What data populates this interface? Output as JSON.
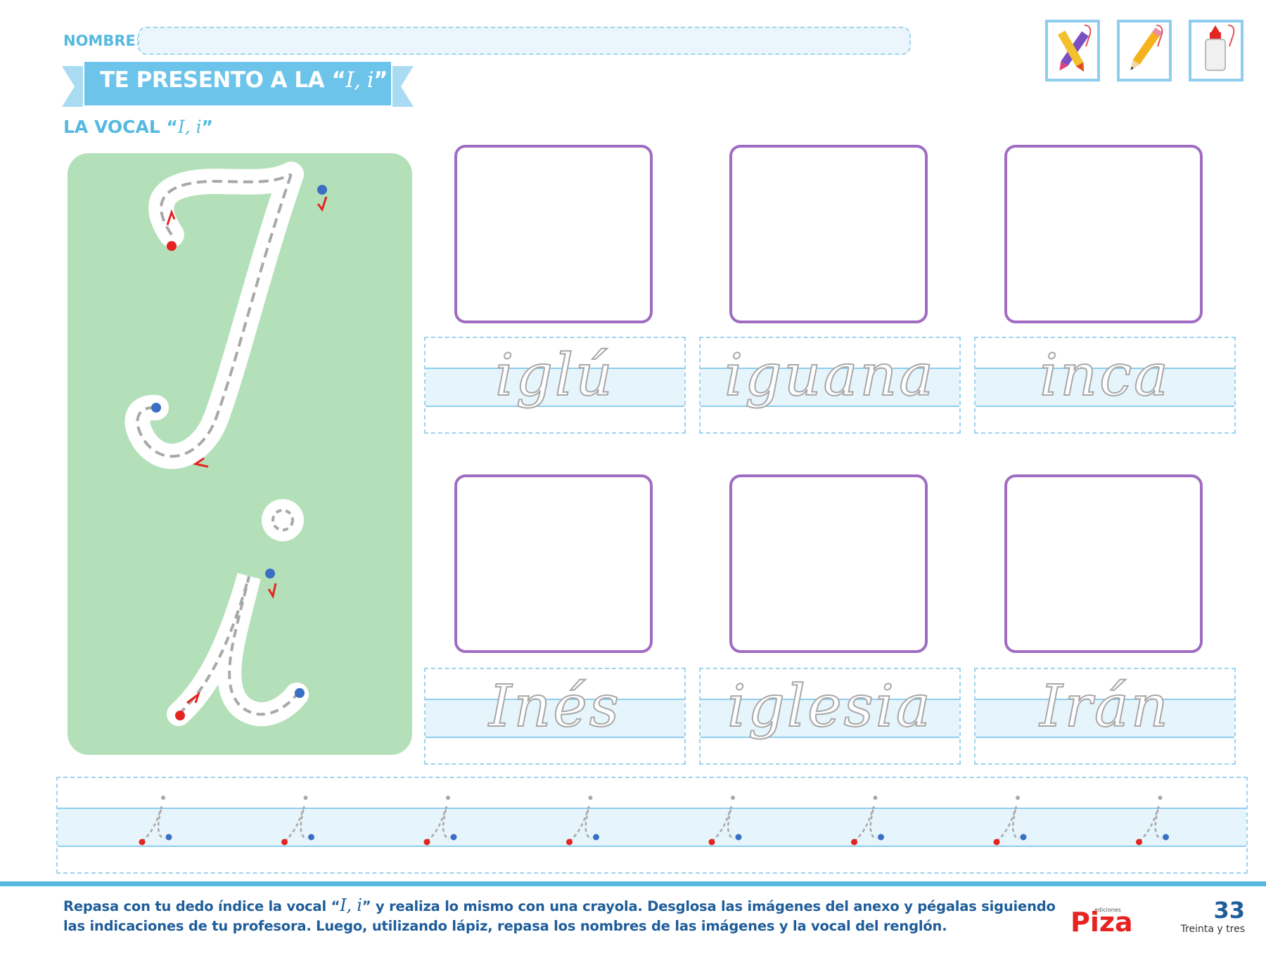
{
  "header": {
    "name_label": "NOMBRE:",
    "title_prefix": "TE PRESENTO A LA “",
    "title_letters": "I, i",
    "title_suffix": "”",
    "subtitle_prefix": "LA VOCAL “",
    "subtitle_letters": "I, i",
    "subtitle_suffix": "”"
  },
  "tools": [
    {
      "icon": "crayons-icon"
    },
    {
      "icon": "pencil-icon"
    },
    {
      "icon": "glue-icon"
    }
  ],
  "words": [
    "iglú",
    "iguana",
    "inca",
    "Inés",
    "iglesia",
    "Irán"
  ],
  "practice": {
    "letter": "i",
    "repetitions": 8
  },
  "footer": {
    "instructions_1": "Repasa con tu dedo índice la vocal “",
    "instructions_letters": "I,  i",
    "instructions_2": "” y realiza lo mismo con una crayola. Desglosa las imágenes del anexo y pégalas siguiendo las indicaciones de tu profesora. Luego, utilizando lápiz, repasa los nombres de las imágenes y la vocal del renglón.",
    "brand_small": "ediciones",
    "brand": "Piza",
    "page_number": "33",
    "page_words": "Treinta y tres"
  },
  "colors": {
    "accent": "#55b9e0",
    "panel_green": "#b3e0b8",
    "frame_purple": "#a06cc2",
    "start_dot": "#e52421",
    "end_dot": "#3a6fc4",
    "text_blue": "#1f5d9a"
  }
}
